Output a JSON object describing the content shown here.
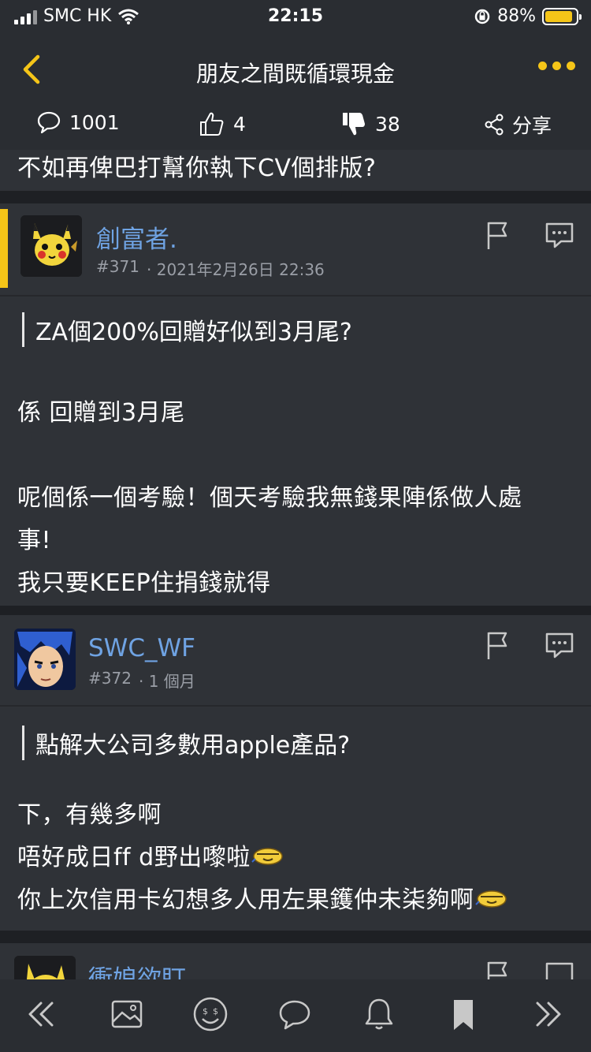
{
  "status": {
    "carrier": "SMC HK",
    "time": "22:15",
    "battery": "88%",
    "battery_level": 0.88
  },
  "nav": {
    "title": "朋友之間既循環現金"
  },
  "actions": {
    "comments": "1001",
    "likes": "4",
    "dislikes": "38",
    "share": "分享"
  },
  "feed": {
    "prev_tail": "不如再俾巴打幫你執下CV個排版?",
    "posts": [
      {
        "username": "創富者.",
        "number": "#371",
        "time": "· 2021年2月26日 22:36",
        "quote": "ZA個200%回贈好似到3月尾?",
        "body": [
          "係 回贈到3月尾",
          "",
          "呢個係一個考驗！個天考驗我無錢果陣係做人處",
          "事!",
          "我只要KEEP住捐錢就得"
        ]
      },
      {
        "username": "SWC_WF",
        "number": "#372",
        "time": "· 1 個月",
        "quote": "點解大公司多數用apple產品?",
        "body": [
          "下，有幾多啊",
          "唔好成日ff d野出嚟啦",
          "你上次信用卡幻想多人用左果鑊仲未柒夠啊"
        ]
      },
      {
        "username": "衝娘欲盯"
      }
    ]
  },
  "colors": {
    "accent": "#f5c518",
    "username": "#6fa3e3"
  }
}
